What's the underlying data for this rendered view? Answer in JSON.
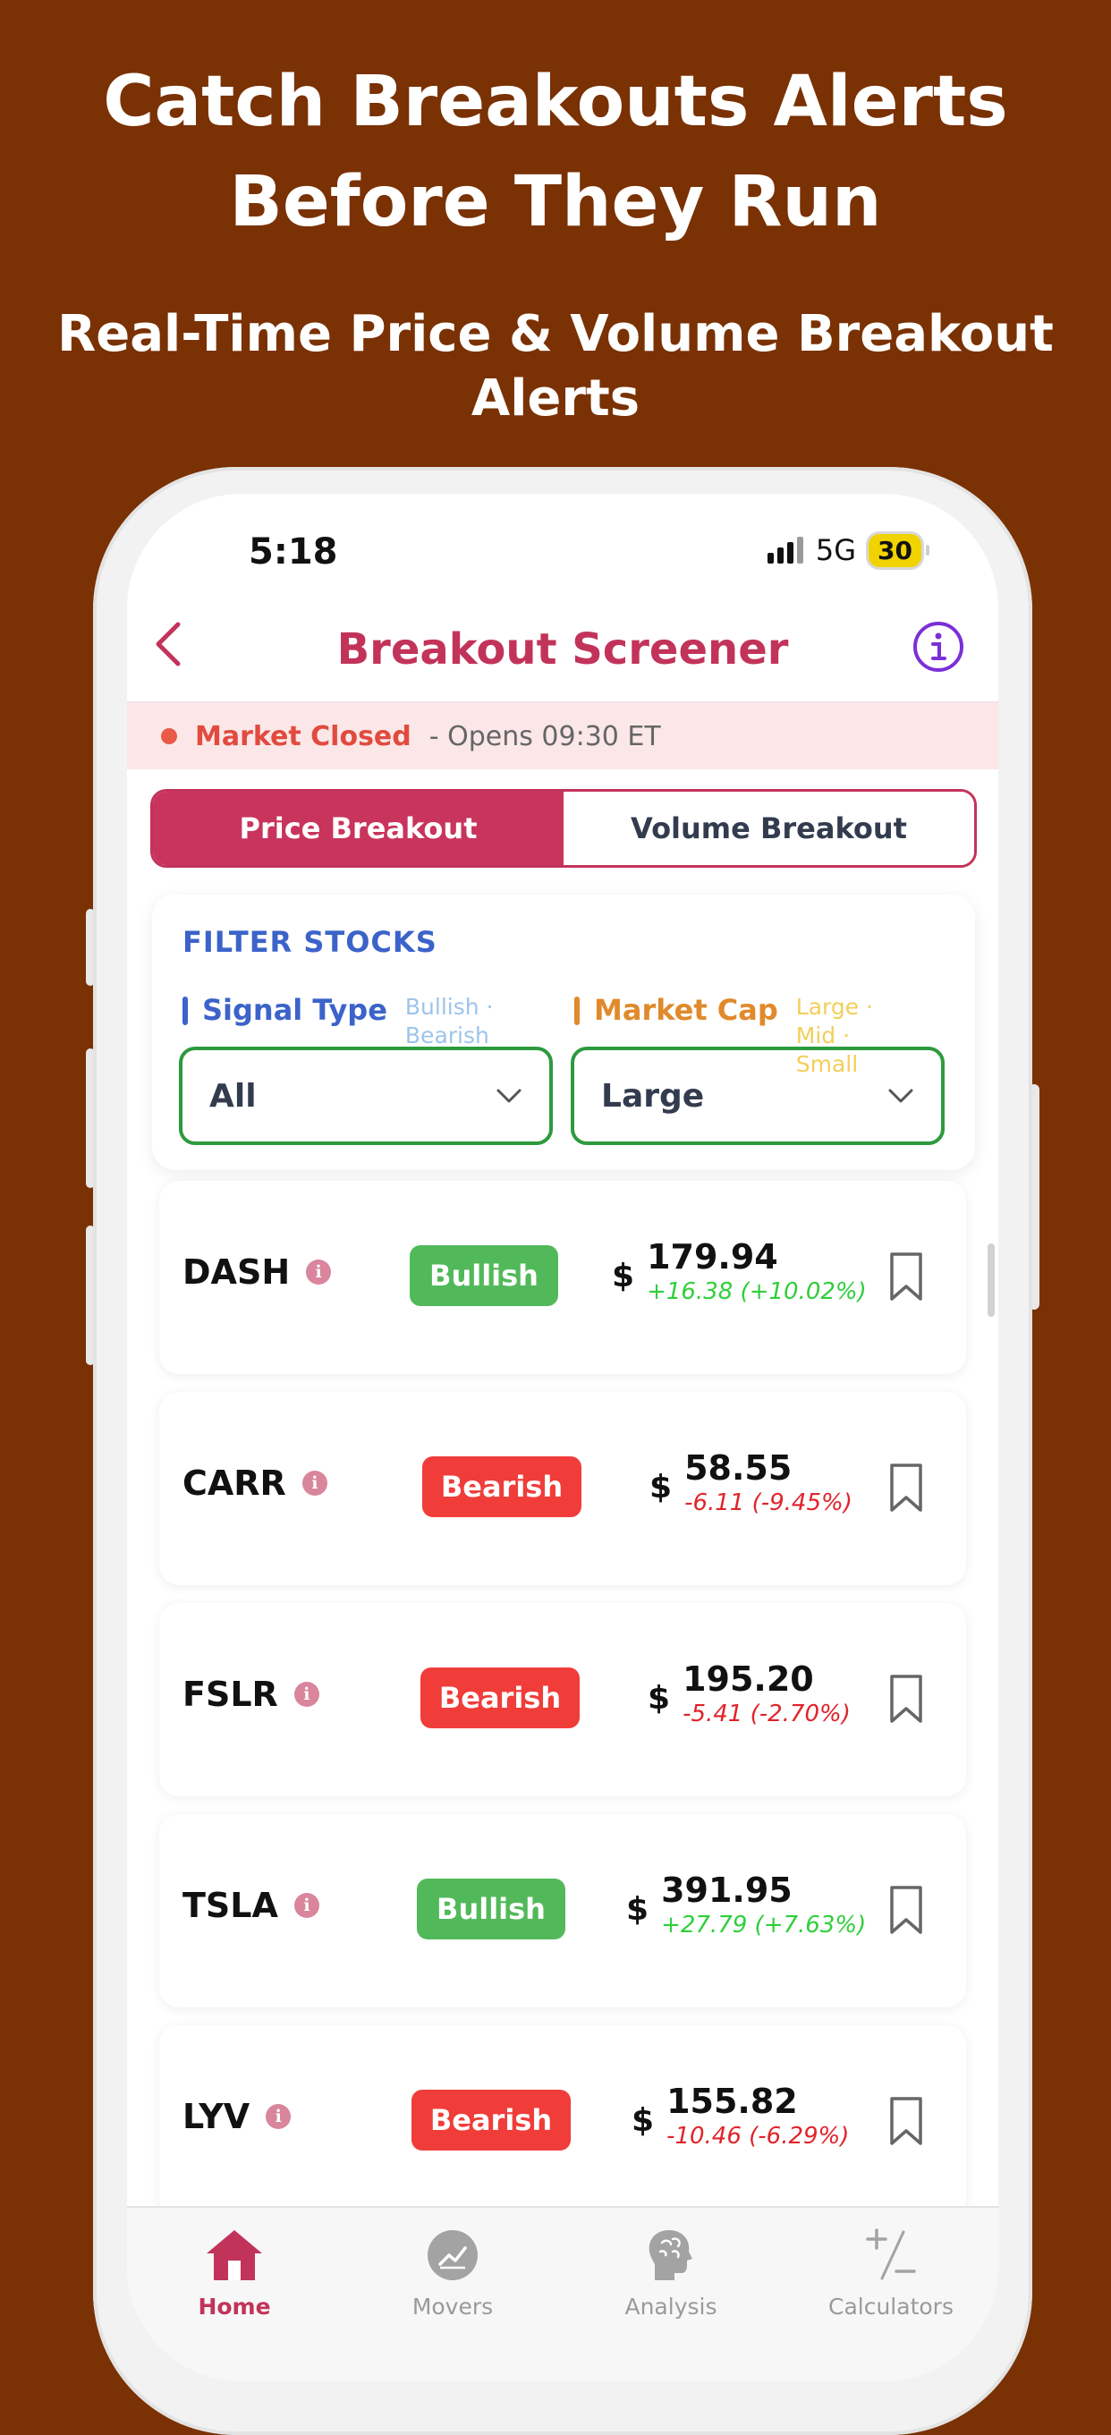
{
  "promo": {
    "headline": "Catch Breakouts Alerts Before They Run",
    "subheadline": "Real-Time Price & Volume Breakout Alerts"
  },
  "status_bar": {
    "time": "5:18",
    "network": "5G",
    "battery": "30"
  },
  "nav": {
    "title": "Breakout Screener",
    "back_icon": "chevron-left-icon",
    "info_icon": "info-circle-icon"
  },
  "market": {
    "status": "Market Closed",
    "opens": "- Opens 09:30 ET"
  },
  "segments": {
    "price": "Price Breakout",
    "volume": "Volume Breakout",
    "active": "price"
  },
  "filter": {
    "title": "FILTER STOCKS",
    "signal_label": "Signal Type",
    "signal_hint": "Bullish · Bearish",
    "signal_value": "All",
    "cap_label": "Market Cap",
    "cap_hint": "Large · Mid · Small",
    "cap_value": "Large"
  },
  "stocks": [
    {
      "ticker": "DASH",
      "signal": "Bullish",
      "price": "179.94",
      "change": "+16.38 (+10.02%)"
    },
    {
      "ticker": "CARR",
      "signal": "Bearish",
      "price": "58.55",
      "change": "-6.11 (-9.45%)"
    },
    {
      "ticker": "FSLR",
      "signal": "Bearish",
      "price": "195.20",
      "change": "-5.41 (-2.70%)"
    },
    {
      "ticker": "TSLA",
      "signal": "Bullish",
      "price": "391.95",
      "change": "+27.79 (+7.63%)"
    },
    {
      "ticker": "LYV",
      "signal": "Bearish",
      "price": "155.82",
      "change": "-10.46 (-6.29%)"
    }
  ],
  "currency_symbol": "$",
  "tabs": [
    {
      "label": "Home",
      "icon": "home-icon",
      "active": true
    },
    {
      "label": "Movers",
      "icon": "chart-icon",
      "active": false
    },
    {
      "label": "Analysis",
      "icon": "brain-icon",
      "active": false
    },
    {
      "label": "Calculators",
      "icon": "plus-minus-icon",
      "active": false
    }
  ],
  "colors": {
    "background": "#7a3103",
    "accent": "#c2335a",
    "bullish": "#52b95a",
    "bearish": "#f03d3a",
    "filter_border": "#2d9a3e"
  }
}
